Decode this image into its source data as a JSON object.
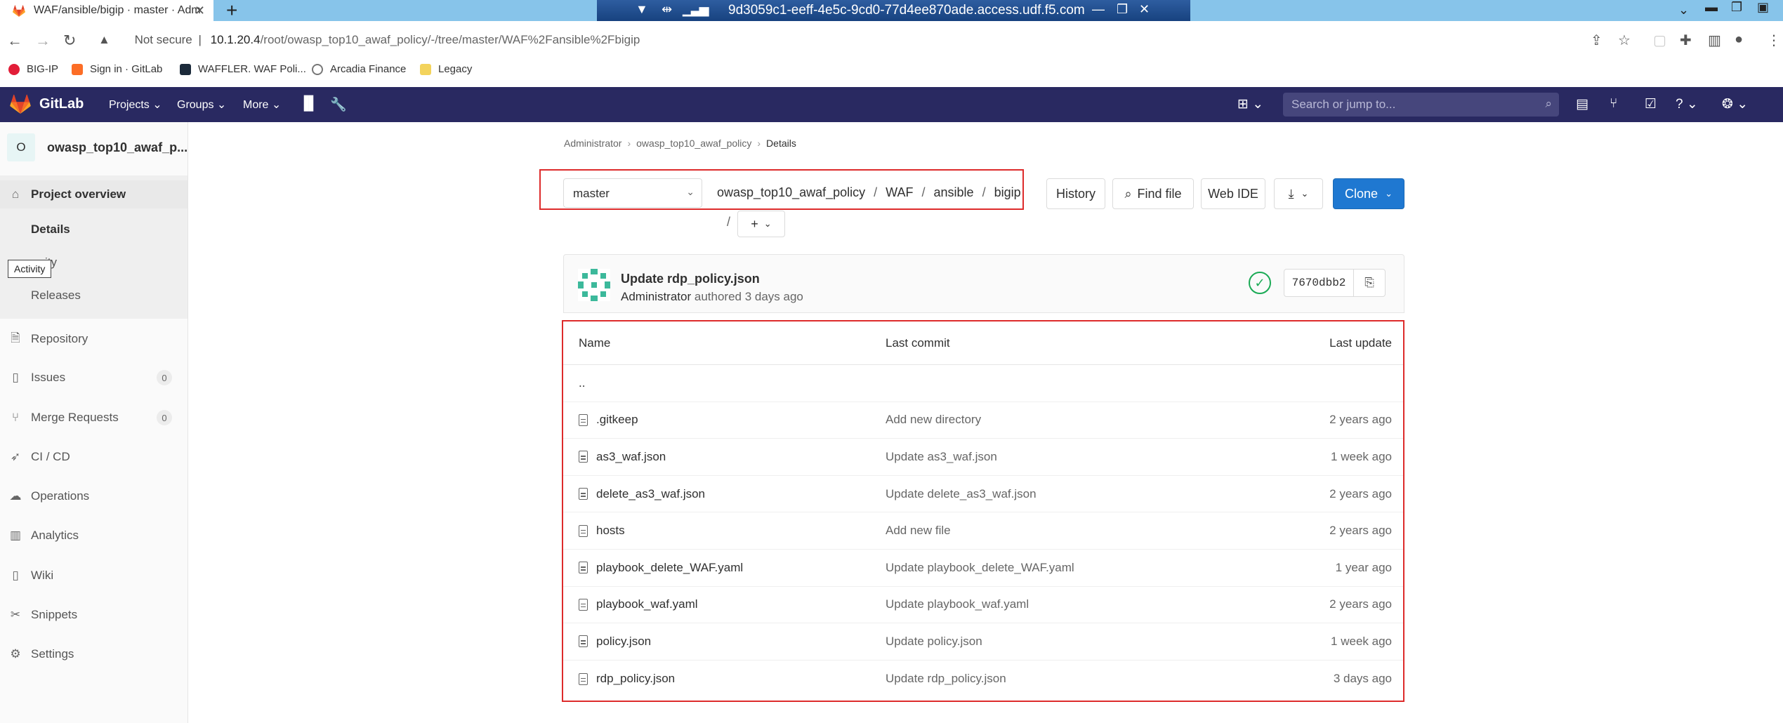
{
  "browser": {
    "tab_title": "WAF/ansible/bigip · master · Adm",
    "tab_close": "✕",
    "new_tab": "+",
    "remote_host": "9d3059c1-eeff-4e5c-9cd0-77d4ee870ade.access.udf.f5.com",
    "security_label": "Not secure",
    "url_host": "10.1.20.4",
    "url_path": "/root/owasp_top10_awaf_policy/-/tree/master/WAF%2Fansible%2Fbigip"
  },
  "bookmarks": [
    {
      "label": "BIG-IP",
      "color": "#e21d38"
    },
    {
      "label": "Sign in · GitLab",
      "color": "#fc6d26"
    },
    {
      "label": "WAFFLER. WAF Poli...",
      "color": "#1b2a3a"
    },
    {
      "label": "Arcadia Finance",
      "color": "#777777"
    },
    {
      "label": "Legacy",
      "color": "#f3d35c"
    }
  ],
  "gitlab": {
    "brand": "GitLab",
    "nav": [
      "Projects",
      "Groups",
      "More"
    ],
    "search_placeholder": "Search or jump to..."
  },
  "sidebar": {
    "project_initial": "O",
    "project_name": "owasp_top10_awaf_p...",
    "items": [
      {
        "label": "Project overview",
        "icon": "home-icon"
      },
      {
        "label": "Repository",
        "icon": "document-icon"
      },
      {
        "label": "Issues",
        "icon": "issues-icon",
        "count": "0"
      },
      {
        "label": "Merge Requests",
        "icon": "merge-request-icon",
        "count": "0"
      },
      {
        "label": "CI / CD",
        "icon": "rocket-icon"
      },
      {
        "label": "Operations",
        "icon": "cloud-gear-icon"
      },
      {
        "label": "Analytics",
        "icon": "chart-icon"
      },
      {
        "label": "Wiki",
        "icon": "book-icon"
      },
      {
        "label": "Snippets",
        "icon": "scissors-icon"
      },
      {
        "label": "Settings",
        "icon": "gear-icon"
      }
    ],
    "sub_items": [
      "Details",
      "Activity",
      "Releases"
    ],
    "tooltip": "Activity",
    "activity_visible": "ity"
  },
  "breadcrumb": [
    "Administrator",
    "owasp_top10_awaf_policy",
    "Details"
  ],
  "repo": {
    "branch": "master",
    "path": [
      "owasp_top10_awaf_policy",
      "WAF",
      "ansible",
      "bigip"
    ],
    "add_label": "+",
    "buttons": {
      "history": "History",
      "find_file": "Find file",
      "web_ide": "Web IDE",
      "clone": "Clone"
    }
  },
  "commit": {
    "title": "Update rdp_policy.json",
    "author": "Administrator",
    "authored": "authored 3 days ago",
    "sha": "7670dbb2",
    "status_color": "#1aaa55"
  },
  "table": {
    "headers": [
      "Name",
      "Last commit",
      "Last update"
    ],
    "parent_dir": "..",
    "rows": [
      {
        "name": ".gitkeep",
        "commit": "Add new directory",
        "updated": "2 years ago"
      },
      {
        "name": "as3_waf.json",
        "commit": "Update as3_waf.json",
        "updated": "1 week ago"
      },
      {
        "name": "delete_as3_waf.json",
        "commit": "Update delete_as3_waf.json",
        "updated": "2 years ago"
      },
      {
        "name": "hosts",
        "commit": "Add new file",
        "updated": "2 years ago"
      },
      {
        "name": "playbook_delete_WAF.yaml",
        "commit": "Update playbook_delete_WAF.yaml",
        "updated": "1 year ago"
      },
      {
        "name": "playbook_waf.yaml",
        "commit": "Update playbook_waf.yaml",
        "updated": "2 years ago"
      },
      {
        "name": "policy.json",
        "commit": "Update policy.json",
        "updated": "1 week ago"
      },
      {
        "name": "rdp_policy.json",
        "commit": "Update rdp_policy.json",
        "updated": "3 days ago"
      }
    ]
  },
  "colors": {
    "header_bg": "#292961",
    "primary": "#1f78d1",
    "highlight": "#dd2b2b"
  }
}
